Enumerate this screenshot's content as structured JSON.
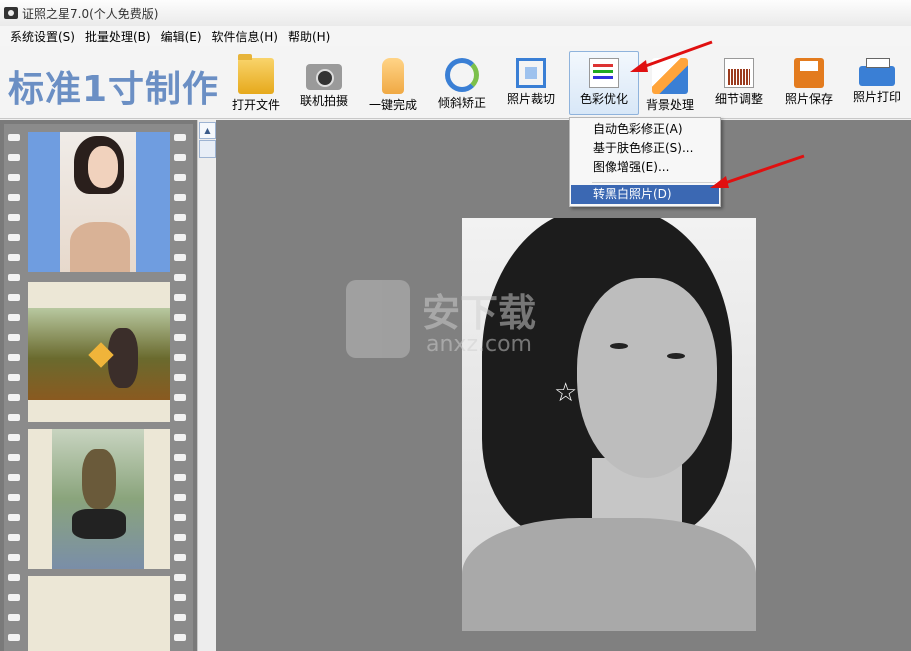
{
  "window": {
    "title": "证照之星7.0(个人免费版)"
  },
  "menu": [
    {
      "label": "系统设置(S)"
    },
    {
      "label": "批量处理(B)"
    },
    {
      "label": "编辑(E)"
    },
    {
      "label": "软件信息(H)"
    },
    {
      "label": "帮助(H)"
    }
  ],
  "toolbar": {
    "brand": "标准1寸制作",
    "tools": [
      {
        "label": "打开文件",
        "icon": "folder-icon"
      },
      {
        "label": "联机拍摄",
        "icon": "camera-icon"
      },
      {
        "label": "一键完成",
        "icon": "hand-icon"
      },
      {
        "label": "倾斜矫正",
        "icon": "rotate-icon"
      },
      {
        "label": "照片裁切",
        "icon": "crop-icon"
      },
      {
        "label": "色彩优化",
        "icon": "color-bars-icon",
        "active": true
      },
      {
        "label": "背景处理",
        "icon": "background-pen-icon"
      },
      {
        "label": "细节调整",
        "icon": "histogram-icon"
      },
      {
        "label": "照片保存",
        "icon": "floppy-icon"
      },
      {
        "label": "照片打印",
        "icon": "printer-icon"
      }
    ]
  },
  "dropdown": {
    "items": [
      {
        "label": "自动色彩修正(A)"
      },
      {
        "label": "基于肤色修正(S)..."
      },
      {
        "label": "图像增强(E)..."
      },
      {
        "label": "转黑白照片(D)",
        "highlighted": true
      }
    ]
  },
  "watermark": {
    "text": "安下载",
    "sub": "anxz.com"
  },
  "colors": {
    "brand": "#6b8fc4",
    "highlight": "#3b68b3",
    "workspace": "#808080",
    "arrow": "#e01010"
  }
}
